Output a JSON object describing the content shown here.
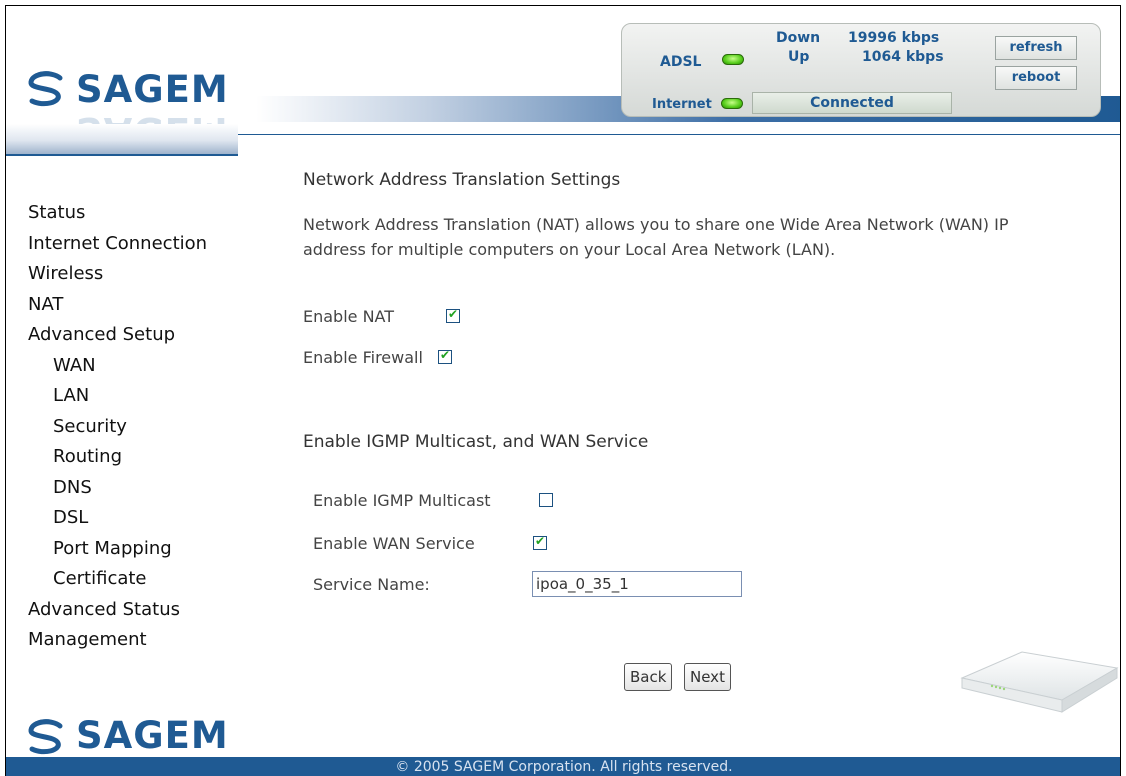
{
  "brand": {
    "name": "SAGEM",
    "color": "#1f5a93"
  },
  "status": {
    "adsl_label": "ADSL",
    "down_label": "Down",
    "down_value": "19996 kbps",
    "up_label": "Up",
    "up_value": "1064 kbps",
    "internet_label": "Internet",
    "connection_state": "Connected",
    "refresh_label": "refresh",
    "reboot_label": "reboot",
    "led_color": "#55cc1a"
  },
  "sidebar": {
    "items": [
      {
        "label": "Status",
        "sub": false
      },
      {
        "label": "Internet Connection",
        "sub": false
      },
      {
        "label": "Wireless",
        "sub": false
      },
      {
        "label": "NAT",
        "sub": false
      },
      {
        "label": "Advanced Setup",
        "sub": false
      },
      {
        "label": "WAN",
        "sub": true
      },
      {
        "label": "LAN",
        "sub": true
      },
      {
        "label": "Security",
        "sub": true
      },
      {
        "label": "Routing",
        "sub": true
      },
      {
        "label": "DNS",
        "sub": true
      },
      {
        "label": "DSL",
        "sub": true
      },
      {
        "label": "Port Mapping",
        "sub": true
      },
      {
        "label": "Certificate",
        "sub": true
      },
      {
        "label": "Advanced Status",
        "sub": false
      },
      {
        "label": "Management",
        "sub": false
      }
    ]
  },
  "main": {
    "nat_heading": "Network Address Translation Settings",
    "nat_description": "Network Address Translation (NAT) allows you to share one Wide Area Network (WAN) IP address for multiple computers on your Local Area Network (LAN).",
    "enable_nat_label": "Enable NAT",
    "enable_nat_checked": true,
    "enable_firewall_label": "Enable Firewall",
    "enable_firewall_checked": true,
    "igmp_heading": "Enable IGMP Multicast, and WAN Service",
    "enable_igmp_label": "Enable IGMP Multicast",
    "enable_igmp_checked": false,
    "enable_wan_label": "Enable WAN Service",
    "enable_wan_checked": true,
    "service_name_label": "Service Name:",
    "service_name_value": "ipoa_0_35_1",
    "back_label": "Back",
    "next_label": "Next"
  },
  "footer": {
    "copyright": "© 2005 SAGEM Corporation. All rights reserved."
  }
}
